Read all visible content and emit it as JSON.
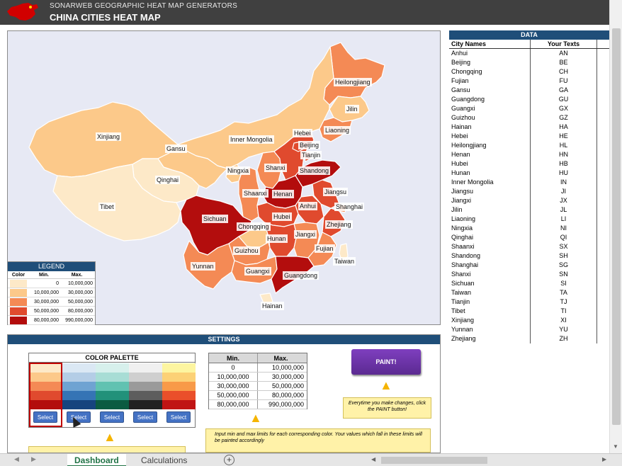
{
  "header": {
    "subtitle": "SONARWEB GEOGRAPHIC HEAT MAP GENERATORS",
    "title": "CHINA CITIES HEAT MAP"
  },
  "colors": {
    "header_bg": "#404040",
    "panel_header": "#1f4e79",
    "band1": "#fde9c8",
    "band2": "#fcc98a",
    "band3": "#f48a55",
    "band4": "#e04a2e",
    "band5": "#b30d0d"
  },
  "map_labels": [
    "Heilongjiang",
    "Jilin",
    "Liaoning",
    "Hebei",
    "Beijing",
    "Tianjin",
    "Inner Mongolia",
    "Xinjiang",
    "Gansu",
    "Ningxia",
    "Shanxi",
    "Shandong",
    "Qinghai",
    "Shaanxi",
    "Henan",
    "Jiangsu",
    "Tibet",
    "Sichuan",
    "Anhui",
    "Shanghai",
    "Hubei",
    "Chongqing",
    "Zhejiang",
    "Hunan",
    "Jiangxi",
    "Guizhou",
    "Fujian",
    "Yunnan",
    "Guangxi",
    "Taiwan",
    "Guangdong",
    "Hainan"
  ],
  "legend": {
    "title": "LEGEND",
    "col_color": "Color",
    "col_min": "Min.",
    "col_max": "Max.",
    "rows": [
      {
        "min": "0",
        "max": "10,000,000"
      },
      {
        "min": "10,000,000",
        "max": "30,000,000"
      },
      {
        "min": "30,000,000",
        "max": "50,000,000"
      },
      {
        "min": "50,000,000",
        "max": "80,000,000"
      },
      {
        "min": "80,000,000",
        "max": "990,000,000"
      }
    ]
  },
  "data_panel": {
    "title": "DATA",
    "col_names": "City Names",
    "col_texts": "Your Texts",
    "rows": [
      {
        "name": "Anhui",
        "code": "AN"
      },
      {
        "name": "Beijing",
        "code": "BE"
      },
      {
        "name": "Chongqing",
        "code": "CH"
      },
      {
        "name": "Fujian",
        "code": "FU"
      },
      {
        "name": "Gansu",
        "code": "GA"
      },
      {
        "name": "Guangdong",
        "code": "GU"
      },
      {
        "name": "Guangxi",
        "code": "GX"
      },
      {
        "name": "Guizhou",
        "code": "GZ"
      },
      {
        "name": "Hainan",
        "code": "HA"
      },
      {
        "name": "Hebei",
        "code": "HE"
      },
      {
        "name": "Heilongjiang",
        "code": "HL"
      },
      {
        "name": "Henan",
        "code": "HN"
      },
      {
        "name": "Hubei",
        "code": "HB"
      },
      {
        "name": "Hunan",
        "code": "HU"
      },
      {
        "name": "Inner Mongolia",
        "code": "IN"
      },
      {
        "name": "Jiangsu",
        "code": "JI"
      },
      {
        "name": "Jiangxi",
        "code": "JX"
      },
      {
        "name": "Jilin",
        "code": "JL"
      },
      {
        "name": "Liaoning",
        "code": "LI"
      },
      {
        "name": "Ningxia",
        "code": "NI"
      },
      {
        "name": "Qinghai",
        "code": "QI"
      },
      {
        "name": "Shaanxi",
        "code": "SX"
      },
      {
        "name": "Shandong",
        "code": "SH"
      },
      {
        "name": "Shanghai",
        "code": "SG"
      },
      {
        "name": "Shanxi",
        "code": "SN"
      },
      {
        "name": "Sichuan",
        "code": "SI"
      },
      {
        "name": "Taiwan",
        "code": "TA"
      },
      {
        "name": "Tianjin",
        "code": "TJ"
      },
      {
        "name": "Tibet",
        "code": "TI"
      },
      {
        "name": "Xinjiang",
        "code": "XI"
      },
      {
        "name": "Yunnan",
        "code": "YU"
      },
      {
        "name": "Zhejiang",
        "code": "ZH"
      }
    ]
  },
  "settings": {
    "title": "SETTINGS",
    "palette_title": "COLOR PALETTE",
    "select_label": "Select",
    "palettes": [
      [
        "#fde9c8",
        "#fcc98a",
        "#f48a55",
        "#e04a2e",
        "#b30d0d"
      ],
      [
        "#dbe8f4",
        "#b4cde6",
        "#6fa3d2",
        "#3574b5",
        "#16447e"
      ],
      [
        "#d7f0ec",
        "#a8ddd5",
        "#61c2b1",
        "#22917a",
        "#0b5b41"
      ],
      [
        "#f0f0f0",
        "#cfcfcf",
        "#9a9a9a",
        "#5d5d5d",
        "#222222"
      ],
      [
        "#fdf5a0",
        "#fcd176",
        "#f89a48",
        "#ea4f2a",
        "#c01414"
      ]
    ],
    "minmax_col_min": "Min.",
    "minmax_col_max": "Max.",
    "minmax_rows": [
      {
        "min": "0",
        "max": "10,000,000"
      },
      {
        "min": "10,000,000",
        "max": "30,000,000"
      },
      {
        "min": "30,000,000",
        "max": "50,000,000"
      },
      {
        "min": "50,000,000",
        "max": "80,000,000"
      },
      {
        "min": "80,000,000",
        "max": "990,000,000"
      }
    ],
    "paint_label": "PAINT!",
    "note_paint": "Everytime you make changes, click the PAINT button!",
    "note_minmax": "Input min and max limits for each corresponding color. Your values which fall in these limits will be painted accordingly"
  },
  "tabs": {
    "dashboard": "Dashboard",
    "calculations": "Calculations",
    "add": "+"
  }
}
